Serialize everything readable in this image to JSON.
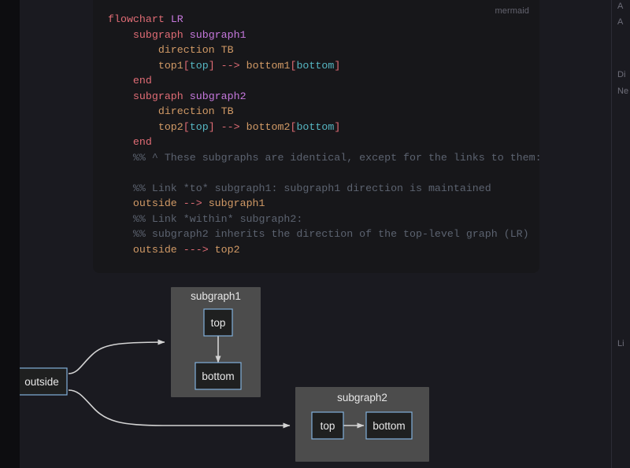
{
  "code_block": {
    "language_label": "mermaid",
    "lines": [
      {
        "indent": 0,
        "tokens": [
          {
            "t": "kw",
            "s": "flowchart"
          },
          {
            "t": "plain",
            "s": " "
          },
          {
            "t": "dir",
            "s": "LR"
          }
        ]
      },
      {
        "indent": 1,
        "tokens": [
          {
            "t": "kw",
            "s": "subgraph"
          },
          {
            "t": "plain",
            "s": " "
          },
          {
            "t": "dir",
            "s": "subgraph1"
          }
        ]
      },
      {
        "indent": 2,
        "tokens": [
          {
            "t": "id",
            "s": "direction TB"
          }
        ]
      },
      {
        "indent": 2,
        "tokens": [
          {
            "t": "id",
            "s": "top1"
          },
          {
            "t": "brk",
            "s": "["
          },
          {
            "t": "lbl",
            "s": "top"
          },
          {
            "t": "brk",
            "s": "]"
          },
          {
            "t": "plain",
            "s": " "
          },
          {
            "t": "arrow",
            "s": "-->"
          },
          {
            "t": "plain",
            "s": " "
          },
          {
            "t": "id",
            "s": "bottom1"
          },
          {
            "t": "brk",
            "s": "["
          },
          {
            "t": "lbl",
            "s": "bottom"
          },
          {
            "t": "brk",
            "s": "]"
          }
        ]
      },
      {
        "indent": 1,
        "tokens": [
          {
            "t": "kw",
            "s": "end"
          }
        ]
      },
      {
        "indent": 1,
        "tokens": [
          {
            "t": "kw",
            "s": "subgraph"
          },
          {
            "t": "plain",
            "s": " "
          },
          {
            "t": "dir",
            "s": "subgraph2"
          }
        ]
      },
      {
        "indent": 2,
        "tokens": [
          {
            "t": "id",
            "s": "direction TB"
          }
        ]
      },
      {
        "indent": 2,
        "tokens": [
          {
            "t": "id",
            "s": "top2"
          },
          {
            "t": "brk",
            "s": "["
          },
          {
            "t": "lbl",
            "s": "top"
          },
          {
            "t": "brk",
            "s": "]"
          },
          {
            "t": "plain",
            "s": " "
          },
          {
            "t": "arrow",
            "s": "-->"
          },
          {
            "t": "plain",
            "s": " "
          },
          {
            "t": "id",
            "s": "bottom2"
          },
          {
            "t": "brk",
            "s": "["
          },
          {
            "t": "lbl",
            "s": "bottom"
          },
          {
            "t": "brk",
            "s": "]"
          }
        ]
      },
      {
        "indent": 1,
        "tokens": [
          {
            "t": "kw",
            "s": "end"
          }
        ]
      },
      {
        "indent": 1,
        "tokens": [
          {
            "t": "cmt",
            "s": "%% ^ These subgraphs are identical, except for the links to them:"
          }
        ]
      },
      {
        "indent": 0,
        "tokens": []
      },
      {
        "indent": 1,
        "tokens": [
          {
            "t": "cmt",
            "s": "%% Link *to* subgraph1: subgraph1 direction is maintained"
          }
        ]
      },
      {
        "indent": 1,
        "tokens": [
          {
            "t": "id",
            "s": "outside"
          },
          {
            "t": "plain",
            "s": " "
          },
          {
            "t": "arrow",
            "s": "-->"
          },
          {
            "t": "plain",
            "s": " "
          },
          {
            "t": "id",
            "s": "subgraph1"
          }
        ]
      },
      {
        "indent": 1,
        "tokens": [
          {
            "t": "cmt",
            "s": "%% Link *within* subgraph2:"
          }
        ]
      },
      {
        "indent": 1,
        "tokens": [
          {
            "t": "cmt",
            "s": "%% subgraph2 inherits the direction of the top-level graph (LR)"
          }
        ]
      },
      {
        "indent": 1,
        "tokens": [
          {
            "t": "id",
            "s": "outside"
          },
          {
            "t": "plain",
            "s": " "
          },
          {
            "t": "arrow",
            "s": "--->"
          },
          {
            "t": "plain",
            "s": " "
          },
          {
            "t": "id",
            "s": "top2"
          }
        ]
      }
    ]
  },
  "diagram": {
    "nodes": {
      "outside": "outside",
      "subgraph1_top": "top",
      "subgraph1_bottom": "bottom",
      "subgraph2_top": "top",
      "subgraph2_bottom": "bottom"
    },
    "clusters": {
      "subgraph1": "subgraph1",
      "subgraph2": "subgraph2"
    },
    "colors": {
      "cluster_fill": "#4c4c4c",
      "node_fill": "#1f2020",
      "node_stroke": "#81b1db",
      "edge_stroke": "#d3d3d3",
      "label_text": "#e8e8e8"
    }
  },
  "right_sidebar": {
    "links": [
      "A",
      "A",
      "Di",
      "Ne",
      "Li"
    ]
  }
}
